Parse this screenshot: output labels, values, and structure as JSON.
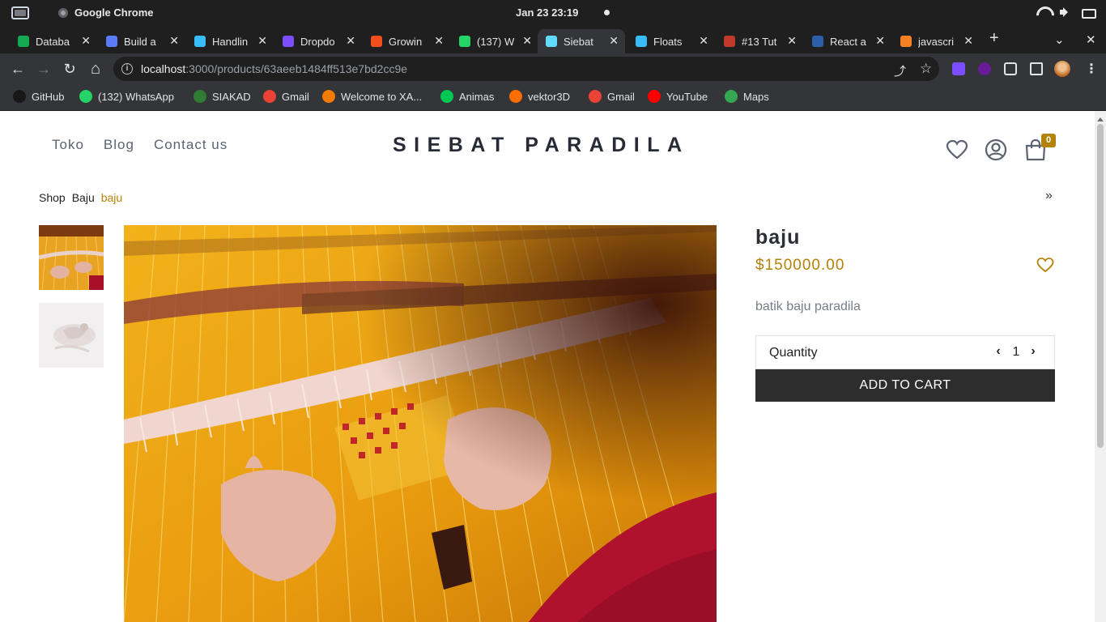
{
  "os": {
    "app_name": "Google Chrome",
    "clock": "Jan 23  23:19"
  },
  "tabs": [
    {
      "title": "Databa",
      "close": "✕",
      "color": "#13aa52"
    },
    {
      "title": "Build a",
      "close": "✕",
      "color": "#5b7cfa"
    },
    {
      "title": "Handlin",
      "close": "✕",
      "color": "#38bdf8"
    },
    {
      "title": "Dropdo",
      "close": "✕",
      "color": "#7c4dff"
    },
    {
      "title": "Growin",
      "close": "✕",
      "color": "#f24e1e"
    },
    {
      "title": "(137) W",
      "close": "✕",
      "color": "#25d366"
    },
    {
      "title": "Siebat",
      "close": "✕",
      "color": "#61dafb"
    },
    {
      "title": "Floats",
      "close": "✕",
      "color": "#38bdf8"
    },
    {
      "title": "#13 Tut",
      "close": "✕",
      "color": "#c0392b"
    },
    {
      "title": "React a",
      "close": "✕",
      "color": "#2b5fa8"
    },
    {
      "title": "javascri",
      "close": "✕",
      "color": "#f48024"
    }
  ],
  "tabbar": {
    "new_tab": "+",
    "search_tabs": "⌄",
    "close_window": "✕"
  },
  "toolbar": {
    "back": "←",
    "forward": "→",
    "reload": "↻",
    "home": "⌂",
    "url_host": "localhost",
    "url_path": ":3000/products/63aeeb1484ff513e7bd2cc9e",
    "share": "⤴",
    "star": "☆",
    "menu": "⋮"
  },
  "bookmarks": [
    {
      "label": "GitHub",
      "color": "#181717"
    },
    {
      "label": "(132) WhatsApp",
      "color": "#25d366"
    },
    {
      "label": "SIAKAD",
      "color": "#2e7d32"
    },
    {
      "label": "Gmail",
      "color": "#ea4335"
    },
    {
      "label": "Welcome to XA...",
      "color": "#f57c00"
    },
    {
      "label": "Animas",
      "color": "#00c853"
    },
    {
      "label": "vektor3D",
      "color": "#ff6d00"
    },
    {
      "label": "Gmail",
      "color": "#ea4335"
    },
    {
      "label": "YouTube",
      "color": "#ff0000"
    },
    {
      "label": "Maps",
      "color": "#34a853"
    }
  ],
  "site": {
    "nav": [
      "Toko",
      "Blog",
      "Contact us"
    ],
    "brand": "SIEBAT PARADILA",
    "cart_count": "0"
  },
  "breadcrumb": {
    "items": [
      "Shop",
      "Baju"
    ],
    "current": "baju",
    "more": "»"
  },
  "product": {
    "name": "baju",
    "price": "$150000.00",
    "description": "batik baju paradila",
    "quantity_label": "Quantity",
    "quantity_value": "1",
    "decrease": "‹",
    "increase": "›",
    "add_to_cart": "ADD TO CART"
  },
  "colors": {
    "accent_gold": "#b58209",
    "button_dark": "#2d2d2d",
    "brand_text": "#272b36"
  }
}
